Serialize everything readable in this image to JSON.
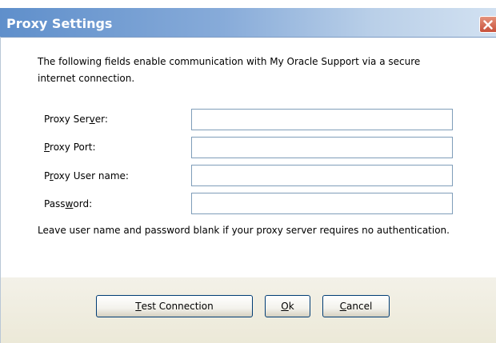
{
  "dialog": {
    "title": "Proxy Settings"
  },
  "intro": {
    "line1": "The following fields enable communication with My Oracle Support via a secure",
    "line2": "internet connection."
  },
  "fields": {
    "proxy_server": {
      "label_pre": "Proxy Ser",
      "label_mnemonic": "v",
      "label_post": "er:",
      "value": ""
    },
    "proxy_port": {
      "label_pre": "",
      "label_mnemonic": "P",
      "label_post": "roxy Port:",
      "value": ""
    },
    "proxy_user": {
      "label_pre": "P",
      "label_mnemonic": "r",
      "label_post": "oxy User name:",
      "value": ""
    },
    "password": {
      "label_pre": "Pass",
      "label_mnemonic": "w",
      "label_post": "ord:",
      "value": ""
    }
  },
  "note": "Leave user name and password blank if your proxy server requires no authentication.",
  "buttons": {
    "test_connection": {
      "mnemonic": "T",
      "rest": "est Connection"
    },
    "ok": {
      "mnemonic": "O",
      "rest": "k"
    },
    "cancel": {
      "mnemonic": "C",
      "rest": "ancel"
    }
  },
  "icons": {
    "close": "close-icon"
  }
}
